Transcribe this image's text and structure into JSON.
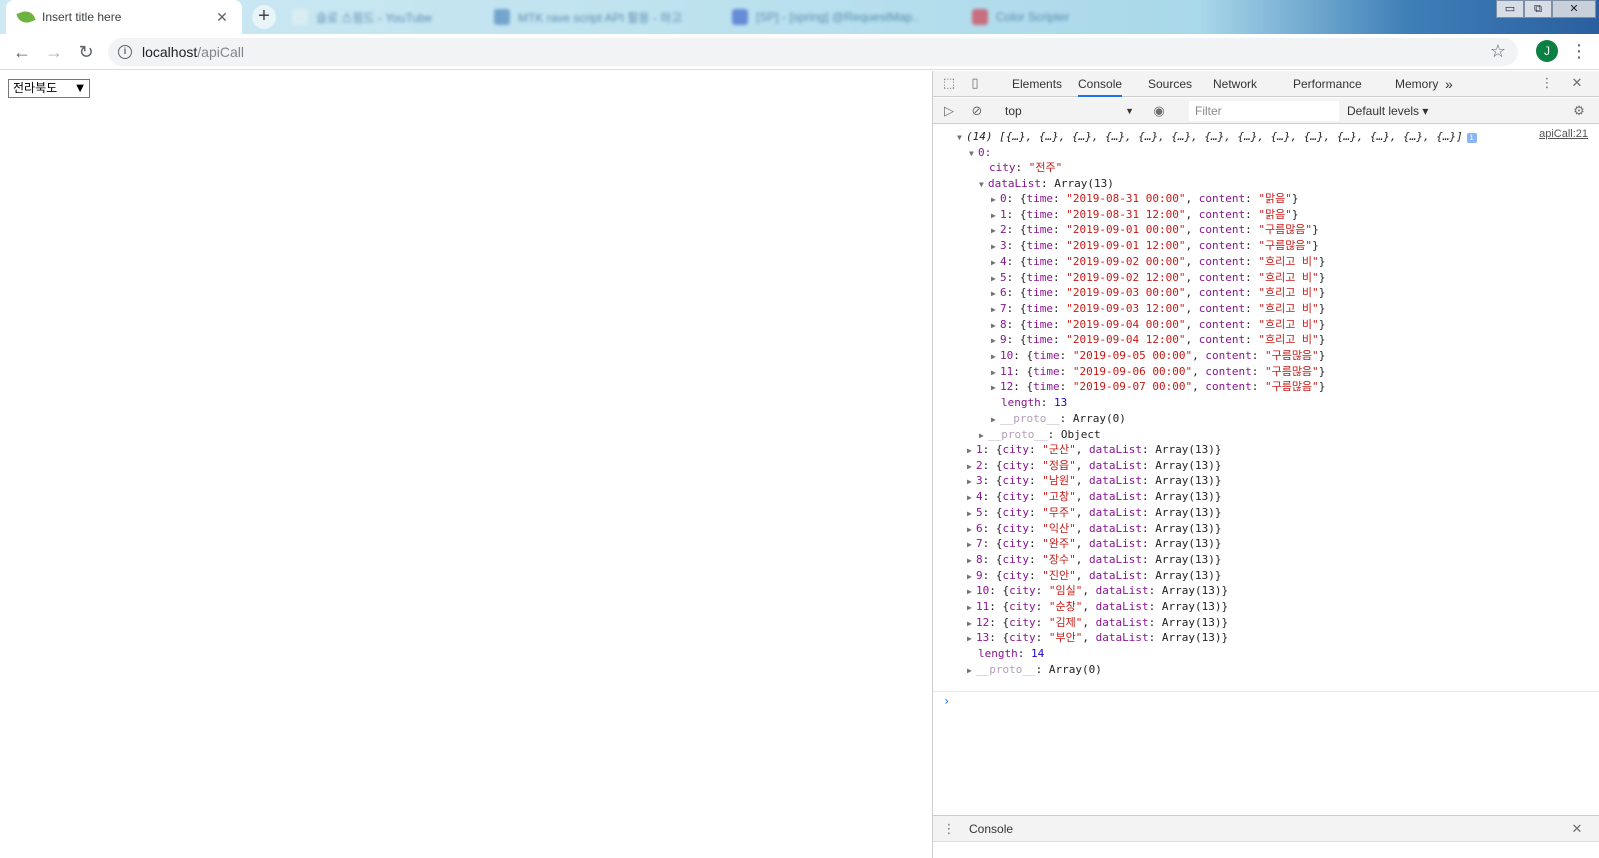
{
  "browser": {
    "tabs": [
      {
        "title": "Insert title here",
        "active": true
      },
      {
        "title": "슬로 스윙드 - YouTube",
        "active": false
      },
      {
        "title": "MTK rave script API 활용 - 하고",
        "active": false
      },
      {
        "title": "[SP] - [spring] @RequestMap..",
        "active": false
      },
      {
        "title": "Color Scripter",
        "active": false
      }
    ],
    "new_tab_label": "+",
    "tab_close_label": "✕",
    "url_host": "localhost",
    "url_path": "/apiCall",
    "avatar_letter": "J",
    "back_label": "←",
    "forward_label": "→",
    "reload_label": "↻",
    "star_label": "☆",
    "menu_label": "⋮",
    "window_controls": [
      "▭",
      "⧉",
      "✕"
    ]
  },
  "page": {
    "region_select": {
      "value": "전라북도",
      "arrow": "▼"
    }
  },
  "devtools": {
    "tabs": [
      "Elements",
      "Console",
      "Sources",
      "Network",
      "Performance",
      "Memory"
    ],
    "active_tab": "Console",
    "more_tabs_label": "»",
    "context": "top",
    "filter_placeholder": "Filter",
    "levels_label": "Default levels ▾",
    "source_link": "apiCall:21",
    "drawer_title": "Console",
    "accent_color": "#1a73e8",
    "root": {
      "count": "(14)",
      "summary": "[{…}, {…}, {…}, {…}, {…}, {…}, {…}, {…}, {…}, {…}, {…}, {…}, {…}, {…}]",
      "first_index": "0:",
      "first_city": "\"전주\"",
      "datalist_label": "dataList",
      "datalist_type": "Array(13)",
      "data_list": [
        {
          "time": "\"2019-08-31 00:00\"",
          "content": "\"맑음\""
        },
        {
          "time": "\"2019-08-31 12:00\"",
          "content": "\"맑음\""
        },
        {
          "time": "\"2019-09-01 00:00\"",
          "content": "\"구름많음\""
        },
        {
          "time": "\"2019-09-01 12:00\"",
          "content": "\"구름많음\""
        },
        {
          "time": "\"2019-09-02 00:00\"",
          "content": "\"흐리고 비\""
        },
        {
          "time": "\"2019-09-02 12:00\"",
          "content": "\"흐리고 비\""
        },
        {
          "time": "\"2019-09-03 00:00\"",
          "content": "\"흐리고 비\""
        },
        {
          "time": "\"2019-09-03 12:00\"",
          "content": "\"흐리고 비\""
        },
        {
          "time": "\"2019-09-04 00:00\"",
          "content": "\"흐리고 비\""
        },
        {
          "time": "\"2019-09-04 12:00\"",
          "content": "\"흐리고 비\""
        },
        {
          "time": "\"2019-09-05 00:00\"",
          "content": "\"구름많음\""
        },
        {
          "time": "\"2019-09-06 00:00\"",
          "content": "\"구름많음\""
        },
        {
          "time": "\"2019-09-07 00:00\"",
          "content": "\"구름많음\""
        }
      ],
      "datalist_length": "13",
      "datalist_proto": "Array(0)",
      "first_proto": "Object",
      "other_cities": [
        "\"군산\"",
        "\"정읍\"",
        "\"남원\"",
        "\"고창\"",
        "\"무주\"",
        "\"익산\"",
        "\"완주\"",
        "\"장수\"",
        "\"진안\"",
        "\"임실\"",
        "\"순창\"",
        "\"김제\"",
        "\"부안\""
      ],
      "other_datalist": "Array(13)",
      "length": "14",
      "proto": "Array(0)"
    }
  }
}
